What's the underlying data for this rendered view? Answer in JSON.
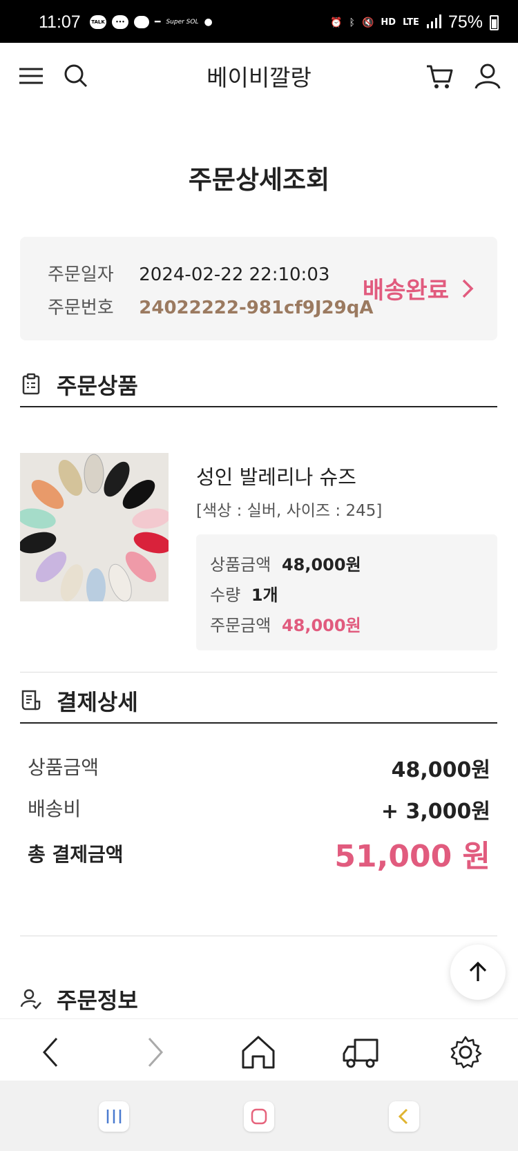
{
  "status_bar": {
    "time": "11:07",
    "notif_talk": "TALK",
    "notif_super": "Super SOL",
    "battery": "75%",
    "hd_voice": "HD",
    "lte": "LTE"
  },
  "header": {
    "brand": "베이비깔랑",
    "icons": [
      "menu-icon",
      "search-icon",
      "cart-icon",
      "user-icon"
    ]
  },
  "page": {
    "title": "주문상세조회"
  },
  "order": {
    "date_label": "주문일자",
    "date_value": "2024-02-22 22:10:03",
    "number_label": "주문번호",
    "number_value": "24022222-981cf9J29qA",
    "status": "배송완료"
  },
  "products_section": {
    "title": "주문상품",
    "items": [
      {
        "name": "성인 발레리나 슈즈",
        "option": "[색상 : 실버, 사이즈 : 245]",
        "price_label": "상품금액",
        "price_value": "48,000원",
        "qty_label": "수량",
        "qty_value": "1개",
        "order_label": "주문금액",
        "order_value": "48,000원"
      }
    ]
  },
  "payment_section": {
    "title": "결제상세",
    "subtotal_label": "상품금액",
    "subtotal_value": "48,000원",
    "shipping_label": "배송비",
    "shipping_value": "+ 3,000원",
    "total_label": "총 결제금액",
    "total_value": "51,000 원"
  },
  "order_info_section": {
    "title": "주문정보"
  },
  "colors": {
    "accent_pink": "#e15b7e",
    "order_number_brown": "#9b7a60",
    "box_bg": "#f5f5f5"
  }
}
